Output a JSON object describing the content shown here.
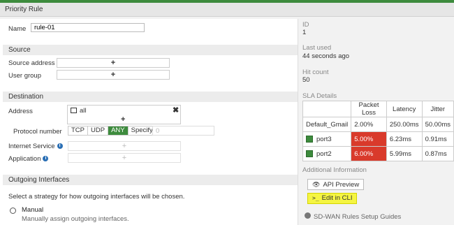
{
  "title": "Priority Rule",
  "name": {
    "label": "Name",
    "value": "rule-01"
  },
  "source": {
    "header": "Source",
    "address_label": "Source address",
    "user_group_label": "User group",
    "plus": "+"
  },
  "destination": {
    "header": "Destination",
    "address_label": "Address",
    "address_value": "all",
    "protocol_label": "Protocol number",
    "protocol_options": [
      "TCP",
      "UDP",
      "ANY",
      "Specify"
    ],
    "protocol_selected": "ANY",
    "protocol_number": "0",
    "internet_service_label": "Internet Service",
    "application_label": "Application",
    "plus": "+"
  },
  "outgoing": {
    "header": "Outgoing Interfaces",
    "description": "Select a strategy for how outgoing interfaces will be chosen.",
    "manual_label": "Manual",
    "manual_desc": "Manually assign outgoing interfaces."
  },
  "details": {
    "id_label": "ID",
    "id_value": "1",
    "last_used_label": "Last used",
    "last_used_value": "44 seconds ago",
    "hit_count_label": "Hit count",
    "hit_count_value": "50",
    "sla_label": "SLA Details",
    "additional_label": "Additional Information",
    "guides_label": "SD-WAN Rules Setup Guides"
  },
  "sla": {
    "headers": [
      "",
      "Packet Loss",
      "Latency",
      "Jitter"
    ],
    "rows": [
      {
        "name": "Default_Gmail",
        "loss": "2.00%",
        "latency": "250.00ms",
        "jitter": "50.00ms",
        "icon": false,
        "bad": false
      },
      {
        "name": "port3",
        "loss": "5.00%",
        "latency": "6.23ms",
        "jitter": "0.91ms",
        "icon": true,
        "bad": true
      },
      {
        "name": "port2",
        "loss": "6.00%",
        "latency": "5.99ms",
        "jitter": "0.87ms",
        "icon": true,
        "bad": true
      }
    ]
  },
  "buttons": {
    "api_preview": "API Preview",
    "edit_cli": "Edit in CLI"
  },
  "colors": {
    "accent": "#3d8b3d",
    "bad": "#d93a2b",
    "highlight": "#f5f542"
  }
}
